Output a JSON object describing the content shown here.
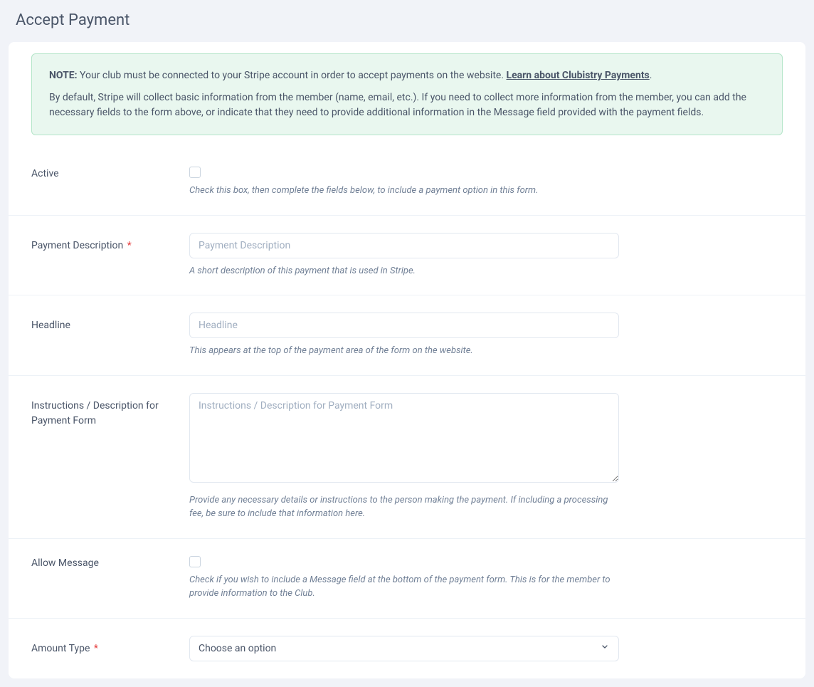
{
  "page": {
    "title": "Accept Payment"
  },
  "alert": {
    "note_label": "NOTE:",
    "note_text": " Your club must be connected to your Stripe account in order to accept payments on the website. ",
    "link_text": "Learn about Clubistry Payments",
    "note_suffix": ".",
    "paragraph2": "By default, Stripe will collect basic information from the member (name, email, etc.). If you need to collect more information from the member, you can add the necessary fields to the form above, or indicate that they need to provide additional information in the Message field provided with the payment fields."
  },
  "fields": {
    "active": {
      "label": "Active",
      "help": "Check this box, then complete the fields below, to include a payment option in this form."
    },
    "payment_description": {
      "label": "Payment Description",
      "placeholder": "Payment Description",
      "help": "A short description of this payment that is used in Stripe.",
      "required": "*"
    },
    "headline": {
      "label": "Headline",
      "placeholder": "Headline",
      "help": "This appears at the top of the payment area of the form on the website."
    },
    "instructions": {
      "label": "Instructions / Description for Payment Form",
      "placeholder": "Instructions / Description for Payment Form",
      "help": "Provide any necessary details or instructions to the person making the payment. If including a processing fee, be sure to include that information here."
    },
    "allow_message": {
      "label": "Allow Message",
      "help": "Check if you wish to include a Message field at the bottom of the payment form. This is for the member to provide information to the Club."
    },
    "amount_type": {
      "label": "Amount Type",
      "required": "*",
      "placeholder_option": "Choose an option"
    }
  }
}
